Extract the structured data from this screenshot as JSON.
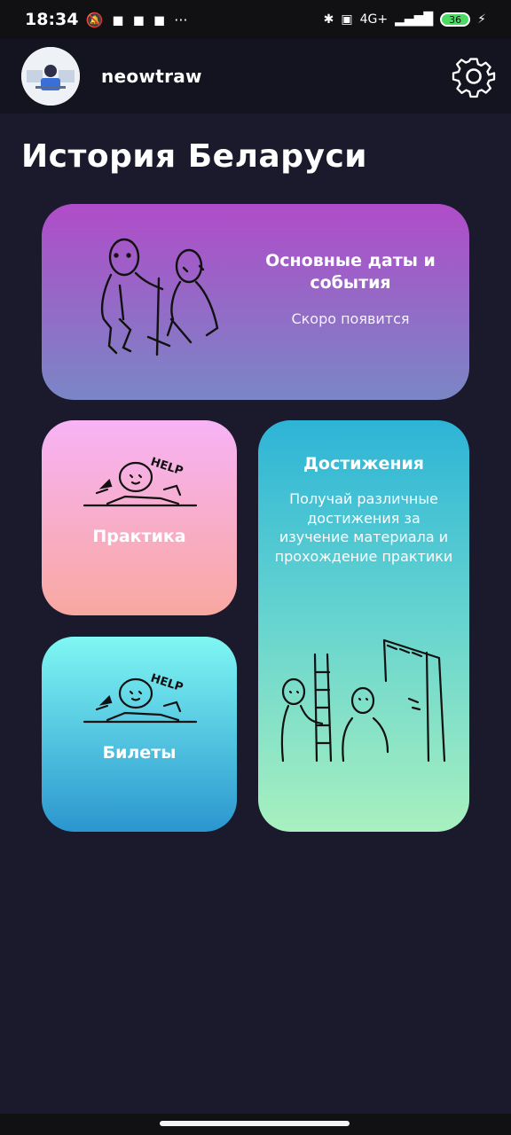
{
  "status_bar": {
    "time": "18:34",
    "icons_left": [
      "mute-icon",
      "game-icon",
      "game-icon",
      "game-icon",
      "more-icon"
    ],
    "network": "4G+",
    "battery": "36"
  },
  "header": {
    "username": "neowtraw"
  },
  "page_title": "История Беларуси",
  "cards": {
    "main": {
      "title": "Основные даты и события",
      "subtitle": "Скоро появится"
    },
    "practice": {
      "title": "Практика"
    },
    "tickets": {
      "title": "Билеты"
    },
    "achievements": {
      "title": "Достижения",
      "description": "Получай различные достижения за изучение материала и прохождение практики"
    }
  }
}
